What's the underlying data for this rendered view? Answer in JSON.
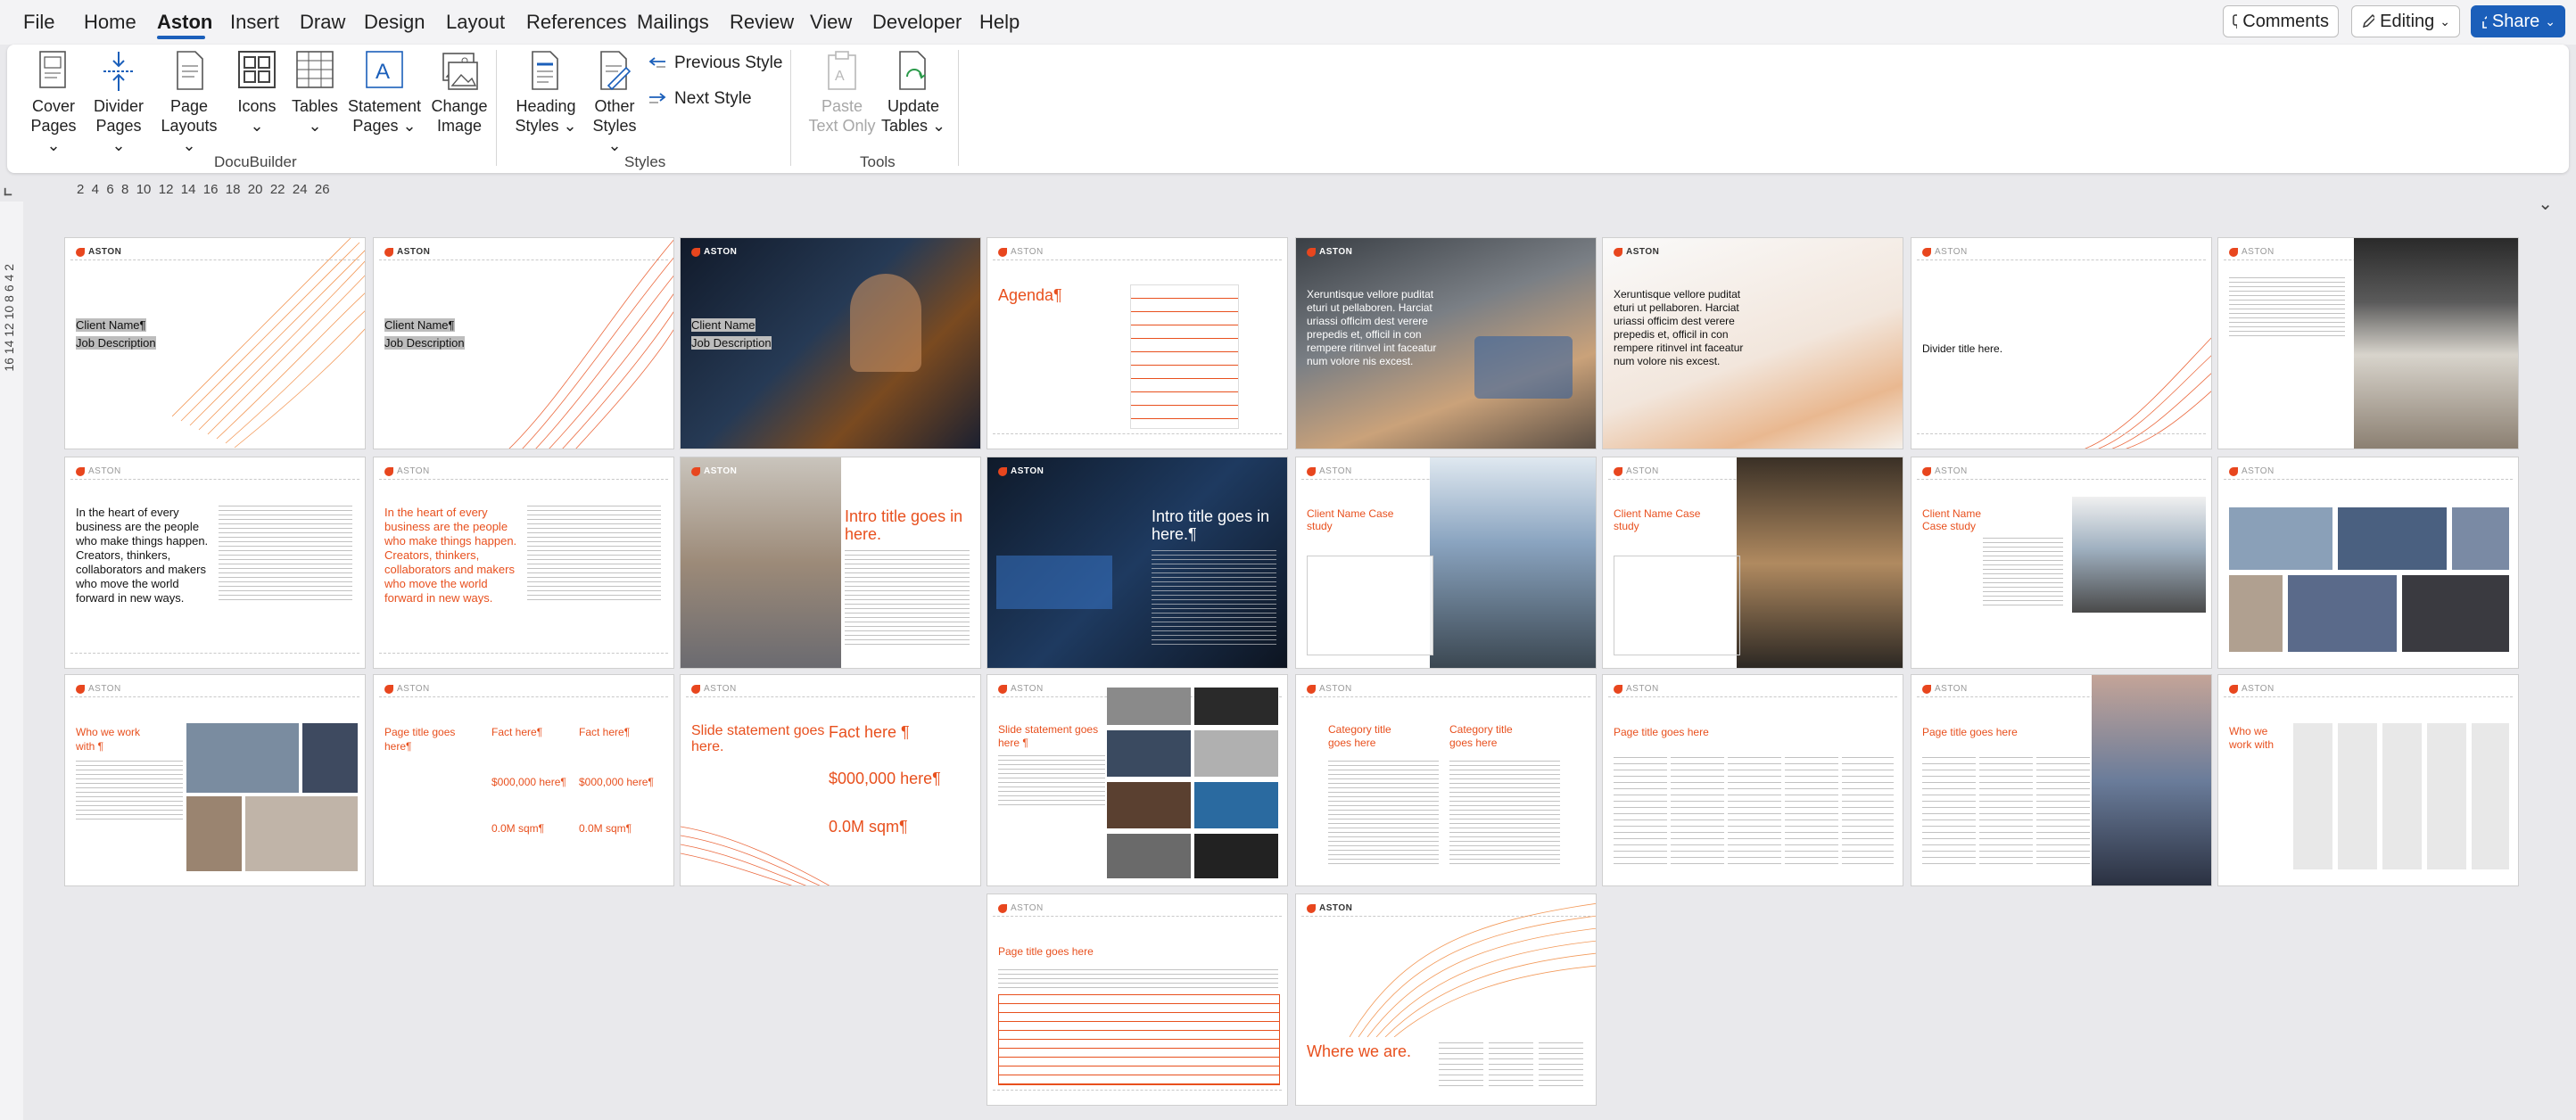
{
  "menu": {
    "items": [
      "File",
      "Home",
      "Aston",
      "Insert",
      "Draw",
      "Design",
      "Layout",
      "References",
      "Mailings",
      "Review",
      "View",
      "Developer",
      "Help"
    ],
    "active": "Aston",
    "comments": "Comments",
    "editing": "Editing",
    "share": "Share"
  },
  "ribbon": {
    "docubuilder": {
      "label": "DocuBuilder",
      "cover_l1": "Cover",
      "cover_l2": "Pages",
      "divider_l1": "Divider",
      "divider_l2": "Pages",
      "layouts_l1": "Page",
      "layouts_l2": "Layouts",
      "icons": "Icons",
      "tables": "Tables",
      "statement_l1": "Statement",
      "statement_l2": "Pages",
      "change_l1": "Change",
      "change_l2": "Image"
    },
    "styles": {
      "label": "Styles",
      "heading_l1": "Heading",
      "heading_l2": "Styles",
      "other_l1": "Other",
      "other_l2": "Styles",
      "previous": "Previous Style",
      "next": "Next Style"
    },
    "tools": {
      "label": "Tools",
      "paste_l1": "Paste",
      "paste_l2": "Text Only",
      "update_l1": "Update",
      "update_l2": "Tables"
    }
  },
  "ruler": {
    "horizontal": "2  4  6  8  10  12  14  16  18  20  22  24  26",
    "vertical": "16 14 12 10 8 6 4 2"
  },
  "pages": {
    "logo": "ASTON",
    "p1_client": "Client Name¶",
    "p1_job": "Job Description",
    "p2_client": "Client Name¶",
    "p2_job": "Job Description",
    "p3_client": "Client Name",
    "p3_job": "Job Description",
    "p4_title": "Agenda¶",
    "p5_text": "Xeruntisque vellore puditat eturi ut pellaboren. Harciat uriassi officim dest verere prepedis et, officil in con rempere ritinvel int faceatur num volore nis excest.",
    "p6_text": "Xeruntisque vellore puditat eturi ut pellaboren. Harciat uriassi officim dest verere prepedis et, officil in con rempere ritinvel int faceatur num volore nis excest.",
    "p7_title": "Divider title here.",
    "p9_text": "In the heart of every business are the people who make things happen. Creators, thinkers, collaborators and makers who move the world forward in new ways.",
    "p10_text": "In the heart of every business are the people who make things happen. Creators, thinkers, collaborators and makers who move the world forward in new ways.",
    "p11_title": "Intro title goes in here.",
    "p12_title": "Intro title goes in here.¶",
    "p13_title": "Client Name Case study",
    "p14_title": "Client Name Case study",
    "p15_title": "Client Name Case study",
    "p17_title": "Who we work with ¶",
    "p18_title": "Page title goes here¶",
    "p18_fact1": "Fact here¶",
    "p18_fact2": "Fact here¶",
    "p18_v1": "$000,000 here¶",
    "p18_v2": "$000,000 here¶",
    "p18_s1": "0.0M sqm¶",
    "p18_s2": "0.0M sqm¶",
    "p19_title": "Slide statement goes here.",
    "p19_fact": "Fact here ¶",
    "p19_v": "$000,000 here¶",
    "p19_s": "0.0M sqm¶",
    "p20_title": "Slide statement goes here ¶",
    "p21_t1": "Category title goes here",
    "p21_t2": "Category title goes here",
    "p22_title": "Page title goes here",
    "p23_title": "Page title goes here",
    "p24_title": "Who we work with",
    "p25_title": "Page title goes here",
    "p26_title": "Where we are."
  },
  "colors": {
    "accent": "#e8501e",
    "ribbon_blue": "#1b5fba"
  }
}
